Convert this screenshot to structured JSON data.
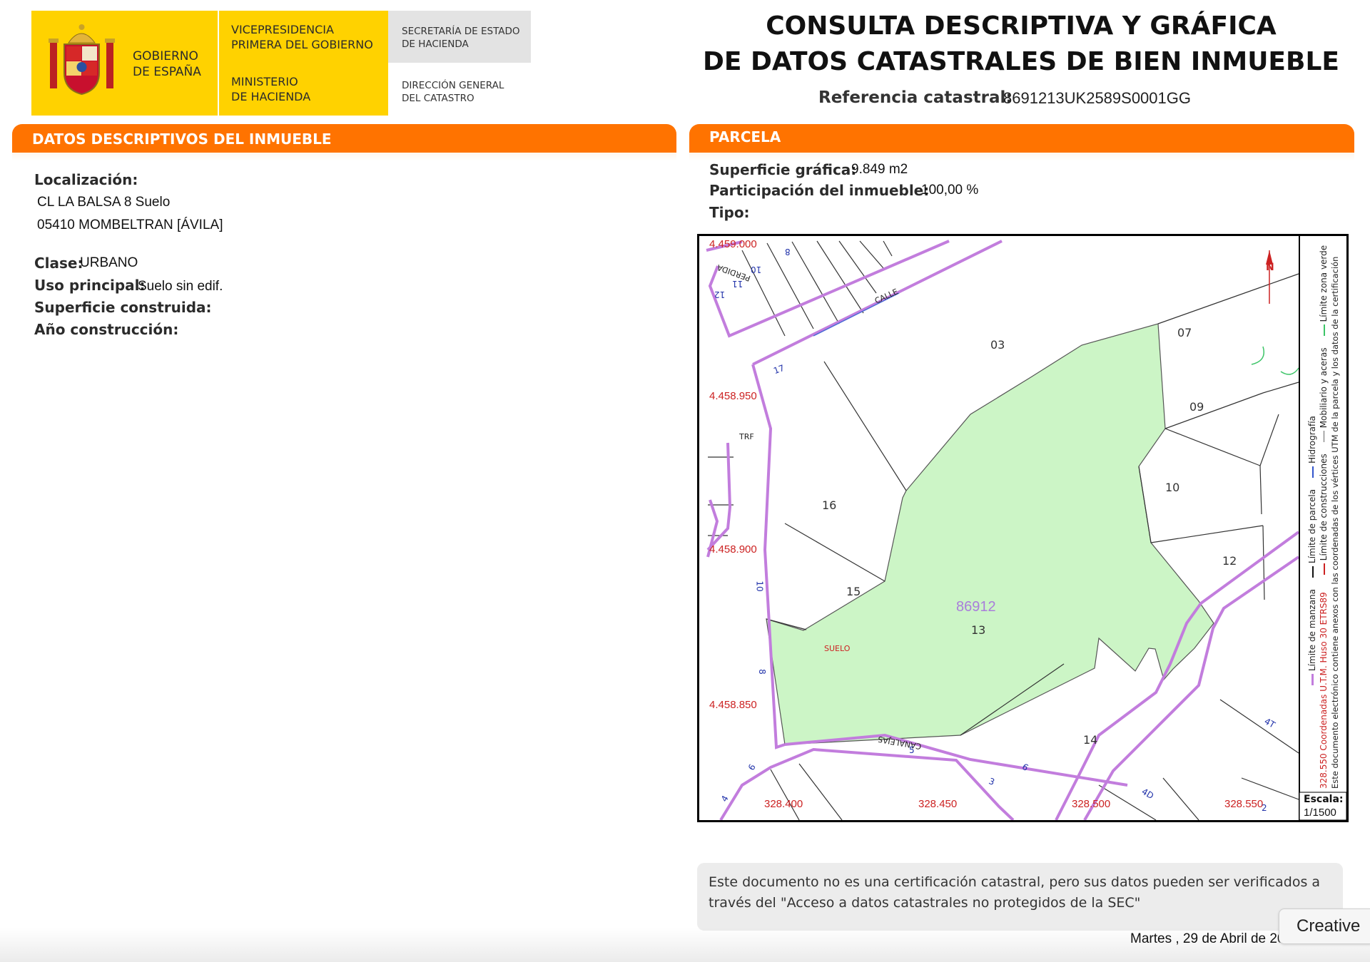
{
  "header": {
    "gobierno": "GOBIERNO\nDE ESPAÑA",
    "vicepresidencia": "VICEPRESIDENCIA\nPRIMERA DEL GOBIERNO",
    "ministerio": "MINISTERIO\nDE HACIENDA",
    "secretaria": "SECRETARÍA DE ESTADO\nDE HACIENDA",
    "direccion": "DIRECCIÓN GENERAL\nDEL CATASTRO",
    "brand_yellow": "#ffd200"
  },
  "title": {
    "line1": "CONSULTA DESCRIPTIVA Y GRÁFICA",
    "line2": "DE DATOS CATASTRALES DE BIEN INMUEBLE",
    "ref_label": "Referencia catastral:",
    "ref_value": "8691213UK2589S0001GG"
  },
  "descriptivos": {
    "section_title": "DATOS DESCRIPTIVOS DEL INMUEBLE",
    "localizacion_label": "Localización:",
    "address_line1": "CL LA BALSA 8 Suelo",
    "address_line2": "05410 MOMBELTRAN [ÁVILA]",
    "clase_label": "Clase:",
    "clase_value": "URBANO",
    "uso_label": "Uso principal:",
    "uso_value": "Suelo sin edif.",
    "superficie_label": "Superficie construida:",
    "anio_label": "Año construcción:"
  },
  "parcela": {
    "section_title": "PARCELA",
    "superficie_label": "Superficie gráfica:",
    "superficie_value": "9.849 m2",
    "participacion_label": "Participación del inmueble:",
    "participacion_value": "100,00 %",
    "tipo_label": "Tipo:"
  },
  "map": {
    "y_coords": [
      "4.459.000",
      "4.458.950",
      "4.458.900",
      "4.458.850"
    ],
    "x_coords": [
      "328.400",
      "328.450",
      "328.500",
      "328.550"
    ],
    "parcel_ref": "86912",
    "parcel_numbers": [
      "03",
      "07",
      "09",
      "10",
      "12",
      "13",
      "14",
      "15",
      "16"
    ],
    "street_labels": [
      "CALLE",
      "PERDIDA",
      "CANALEJAS",
      "TRF",
      "SUELO"
    ],
    "street_numbers": [
      "12",
      "11",
      "10",
      "8",
      "17",
      "10",
      "8",
      "5",
      "3",
      "6",
      "6",
      "4",
      "4D",
      "4T",
      "2"
    ],
    "legend_items": [
      "Límite de manzana",
      "Límite de parcela",
      "Hidrografía",
      "Límite de construcciones",
      "Mobiliario y aceras",
      "Límite zona verde"
    ],
    "legend_note": "Este documento electrónico contiene anexos con las coordenadas de los vértices UTM de la parcela y los datos de la certificación",
    "coord_note": "328.550 Coordenadas U.T.M. Huso 30 ETRS89",
    "escala_label": "Escala:",
    "escala_value": "1/1500",
    "north": "N",
    "colors": {
      "parcel_fill": "#ccf5c6",
      "block_line": "#c27ddd",
      "coord_text": "#cc2222",
      "blue_text": "#2233aa"
    }
  },
  "notice": {
    "text": "Este documento no es una certificación catastral, pero sus datos pueden ser verificados a través del \"Acceso a datos catastrales no protegidos de la SEC\""
  },
  "date": "Martes , 29 de Abril de 2025",
  "creative_badge": "Creative",
  "accent_orange": "#ff7300"
}
